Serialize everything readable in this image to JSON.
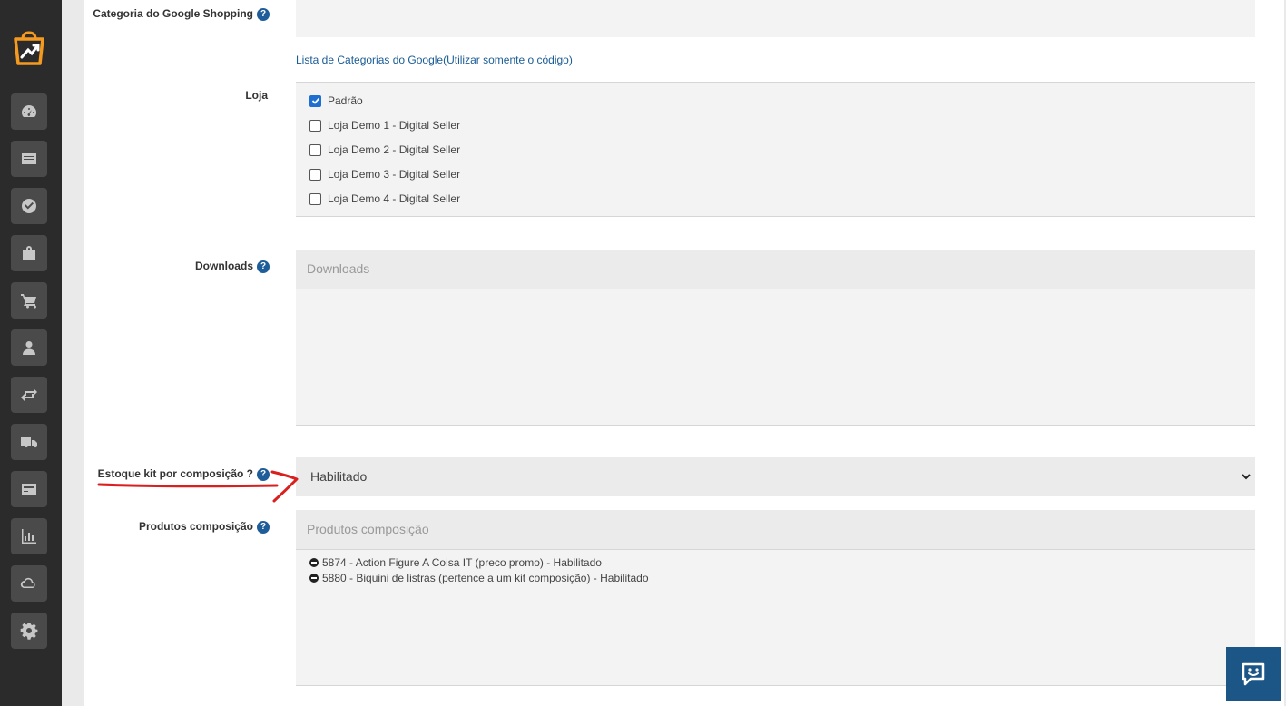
{
  "sidebar": {
    "logo_icon": "shopping-bag-logo-icon",
    "items": [
      {
        "icon": "dashboard-icon"
      },
      {
        "icon": "list-icon"
      },
      {
        "icon": "check-circle-icon"
      },
      {
        "icon": "bag-icon"
      },
      {
        "icon": "cart-icon"
      },
      {
        "icon": "user-icon"
      },
      {
        "icon": "exchange-icon"
      },
      {
        "icon": "truck-icon"
      },
      {
        "icon": "credit-card-icon"
      },
      {
        "icon": "bar-chart-icon"
      },
      {
        "icon": "cloud-icon"
      },
      {
        "icon": "gear-icon"
      }
    ]
  },
  "form": {
    "google_category": {
      "label": "Categoria do Google Shopping",
      "help": "?",
      "link": "Lista de Categorias do Google(Utilizar somente o código)"
    },
    "store": {
      "label": "Loja",
      "options": [
        {
          "label": "Padrão",
          "checked": true
        },
        {
          "label": "Loja Demo 1 - Digital Seller",
          "checked": false
        },
        {
          "label": "Loja Demo 2 - Digital Seller",
          "checked": false
        },
        {
          "label": "Loja Demo 3 - Digital Seller",
          "checked": false
        },
        {
          "label": "Loja Demo 4 - Digital Seller",
          "checked": false
        }
      ]
    },
    "downloads": {
      "label": "Downloads",
      "help": "?",
      "placeholder": "Downloads"
    },
    "kit_stock": {
      "label": "Estoque kit por composição ?",
      "help": "?",
      "value": "Habilitado"
    },
    "composition": {
      "label": "Produtos composição",
      "help": "?",
      "placeholder": "Produtos composição",
      "items": [
        "5874 - Action Figure A Coisa IT (preco promo) - Habilitado",
        "5880 - Biquini de listras (pertence a um kit composição) - Habilitado"
      ]
    }
  },
  "colors": {
    "sidebar_bg": "#2b2b2b",
    "accent": "#1f5d9a",
    "annotation": "#d9201f",
    "chat_bg": "#1c5687"
  },
  "chat": {
    "icon": "chat-icon"
  }
}
